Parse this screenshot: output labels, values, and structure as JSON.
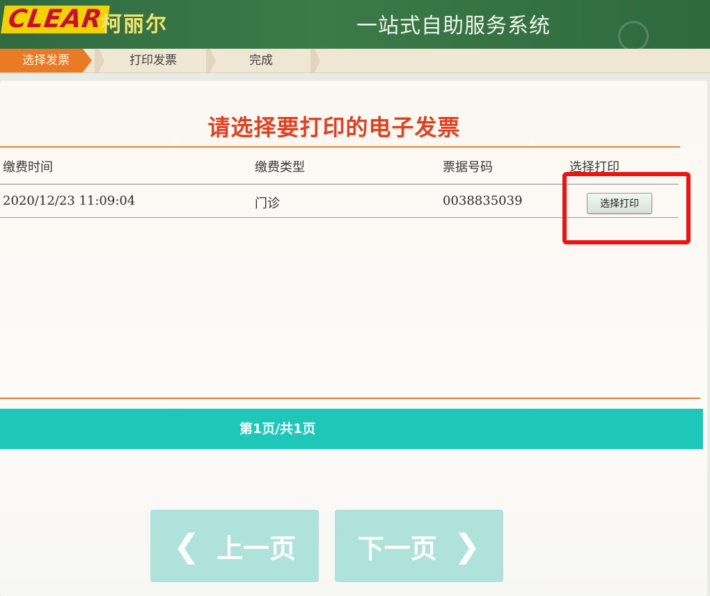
{
  "header": {
    "logo_text": "CLEAR",
    "brand_cn": "柯丽尔",
    "system_title": "一站式自助服务系统"
  },
  "steps": [
    {
      "label": "选择发票",
      "active": true
    },
    {
      "label": "打印发票",
      "active": false
    },
    {
      "label": "完成",
      "active": false
    }
  ],
  "page_title": "请选择要打印的电子发票",
  "table": {
    "columns": [
      "缴费时间",
      "缴费类型",
      "票据号码",
      "选择打印"
    ],
    "rows": [
      {
        "time": "2020/12/23 11:09:04",
        "type": "门诊",
        "number": "0038835039",
        "action": "选择打印"
      }
    ]
  },
  "pagination": {
    "text": "第1页/共1页",
    "prev_label": "上一页",
    "next_label": "下一页"
  },
  "colors": {
    "header_green": "#3c7a4a",
    "active_step": "#ea7a24",
    "title_red": "#e1401f",
    "pager_teal": "#1fc7b8",
    "highlight_red": "#ee1212"
  },
  "icons": {
    "prev": "chevron-left-icon",
    "next": "chevron-right-icon"
  }
}
